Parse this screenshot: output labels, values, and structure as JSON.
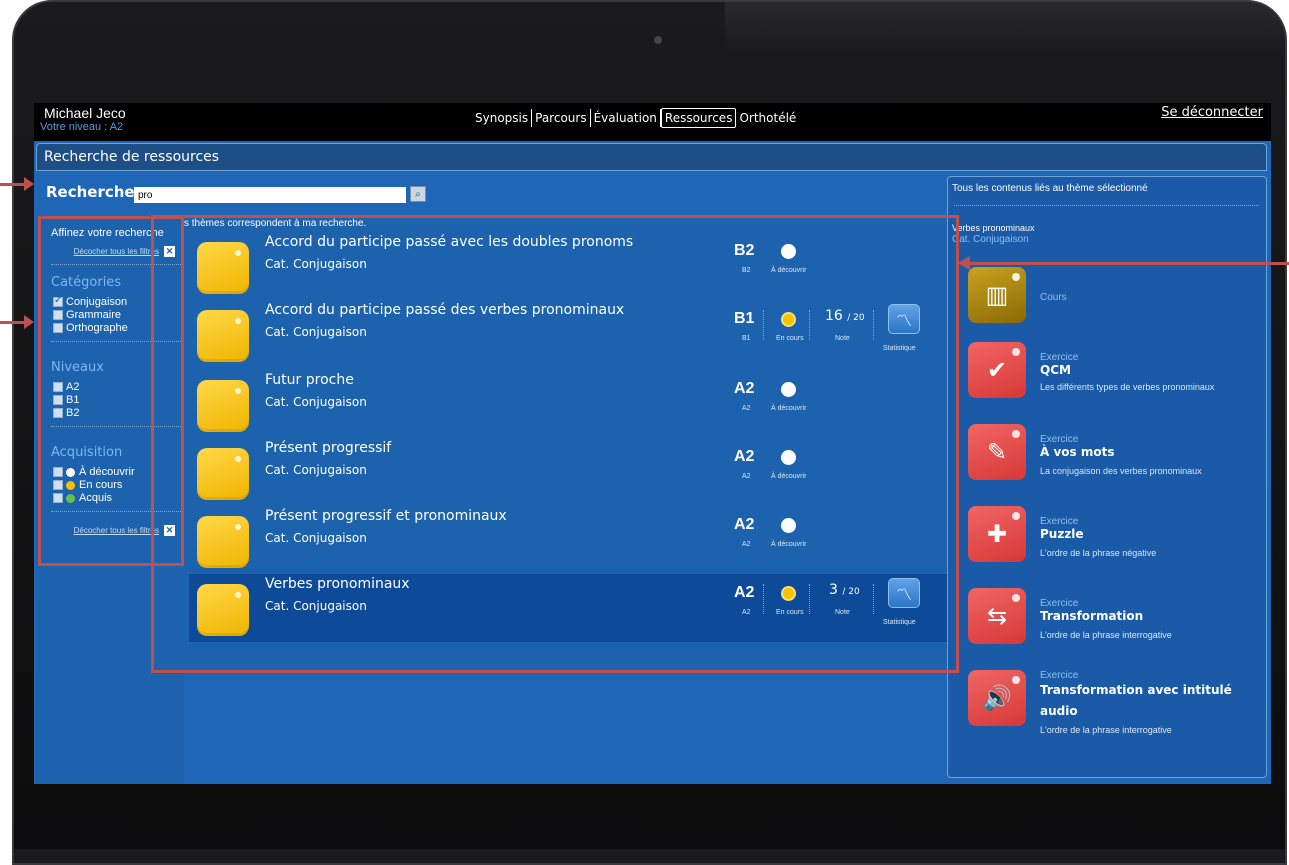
{
  "user": {
    "name": "Michael Jeco",
    "level": "Votre niveau : A2"
  },
  "nav": {
    "tabs": [
      {
        "label": "Synopsis"
      },
      {
        "label": "Parcours"
      },
      {
        "label": "Évaluation"
      },
      {
        "label": "Ressources",
        "active": true
      },
      {
        "label": "Orthotélé"
      }
    ],
    "logout": "Se déconnecter"
  },
  "page_title": "Recherche de ressources",
  "search": {
    "label": "Recherche",
    "value": "pro"
  },
  "filters": {
    "title": "Affinez votre recherche",
    "uncheck_all": "Décocher tous les filtres",
    "categories": {
      "heading": "Catégories",
      "options": [
        {
          "label": "Conjugaison",
          "checked": true
        },
        {
          "label": "Grammaire",
          "checked": false
        },
        {
          "label": "Orthographe",
          "checked": false
        }
      ]
    },
    "levels": {
      "heading": "Niveaux",
      "options": [
        {
          "label": "A2"
        },
        {
          "label": "B1"
        },
        {
          "label": "B2"
        }
      ]
    },
    "acquisition": {
      "heading": "Acquisition",
      "options": [
        {
          "label": "À découvrir",
          "color": "#ffffff"
        },
        {
          "label": "En cours",
          "color": "#f7c200"
        },
        {
          "label": "Acquis",
          "color": "#6cc04a"
        }
      ]
    },
    "uncheck_all_bottom": "Décocher tous les filtres"
  },
  "results": {
    "count_text": "s thèmes correspondent à ma recherche.",
    "items": [
      {
        "title": "Accord du participe passé avec les doubles pronoms",
        "category": "Cat. Conjugaison",
        "level": "B2",
        "level_small": "B2",
        "status": "À découvrir",
        "status_color": "white"
      },
      {
        "title": "Accord du participe passé des verbes pronominaux",
        "category": "Cat. Conjugaison",
        "level": "B1",
        "level_small": "B1",
        "status": "En cours",
        "status_color": "yellow",
        "score": "16",
        "score_max": "/ 20",
        "note_label": "Note",
        "stat_label": "Statistique"
      },
      {
        "title": "Futur proche",
        "category": "Cat. Conjugaison",
        "level": "A2",
        "level_small": "A2",
        "status": "À découvrir",
        "status_color": "white"
      },
      {
        "title": "Présent progressif",
        "category": "Cat. Conjugaison",
        "level": "A2",
        "level_small": "A2",
        "status": "À découvrir",
        "status_color": "white"
      },
      {
        "title": "Présent progressif et pronominaux",
        "category": "Cat. Conjugaison",
        "level": "A2",
        "level_small": "A2",
        "status": "À découvrir",
        "status_color": "white"
      },
      {
        "title": "Verbes pronominaux",
        "category": "Cat. Conjugaison",
        "level": "A2",
        "level_small": "A2",
        "status": "En cours",
        "status_color": "yellow",
        "score": "3",
        "score_max": "/ 20",
        "note_label": "Note",
        "stat_label": "Statistique",
        "selected": true
      }
    ]
  },
  "right_panel": {
    "title": "Tous les contenus liés au thème sélectionné",
    "theme": "Verbes pronominaux",
    "theme_category": "Cat. Conjugaison",
    "resources": [
      {
        "type": "Cours",
        "name": "",
        "desc": "",
        "icon": "books-icon"
      },
      {
        "type": "Exercice",
        "name": "QCM",
        "desc": "Les différents types de verbes pronominaux",
        "icon": "check-icon"
      },
      {
        "type": "Exercice",
        "name": "À vos mots",
        "desc": "La conjugaison des verbes pronominaux",
        "icon": "pencil-icon"
      },
      {
        "type": "Exercice",
        "name": "Puzzle",
        "desc": "L'ordre de la phrase négative",
        "icon": "puzzle-icon"
      },
      {
        "type": "Exercice",
        "name": "Transformation",
        "desc": "L'ordre de la phrase interrogative",
        "icon": "transform-icon"
      },
      {
        "type": "Exercice",
        "name": "Transformation avec intitulé",
        "name2": "audio",
        "desc": "L'ordre de la phrase interrogative",
        "icon": "audio-transform-icon"
      }
    ]
  },
  "colors": {
    "annotation_red": "#c0504d",
    "screen_blue": "#1f67b6",
    "panel_blue": "#1d62ad"
  }
}
